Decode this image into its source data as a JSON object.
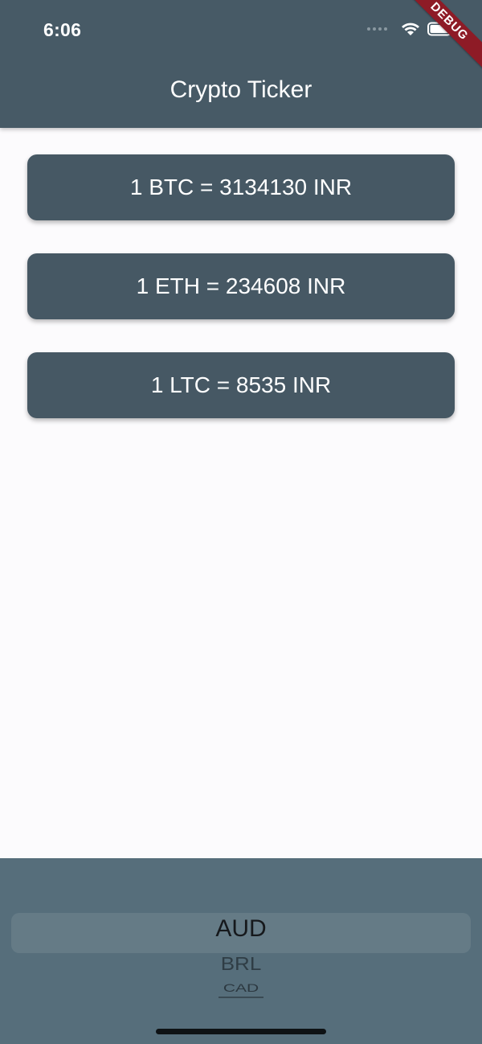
{
  "status_bar": {
    "time": "6:06",
    "icons": [
      "cellular-signal-icon",
      "wifi-icon",
      "battery-icon"
    ]
  },
  "debug_banner": "DEBUG",
  "app_bar": {
    "title": "Crypto Ticker"
  },
  "rates": [
    {
      "label": "1 BTC = 3134130 INR"
    },
    {
      "label": "1 ETH = 234608 INR"
    },
    {
      "label": "1 LTC = 8535 INR"
    }
  ],
  "currency_picker": {
    "selected": "AUD",
    "visible_options": [
      "AUD",
      "BRL",
      "CAD"
    ]
  },
  "colors": {
    "app_bar": "#475a66",
    "card": "#465864",
    "picker_background": "#566e7b",
    "page_background": "#fcfbfd",
    "debug_ribbon": "#8e1b26"
  }
}
